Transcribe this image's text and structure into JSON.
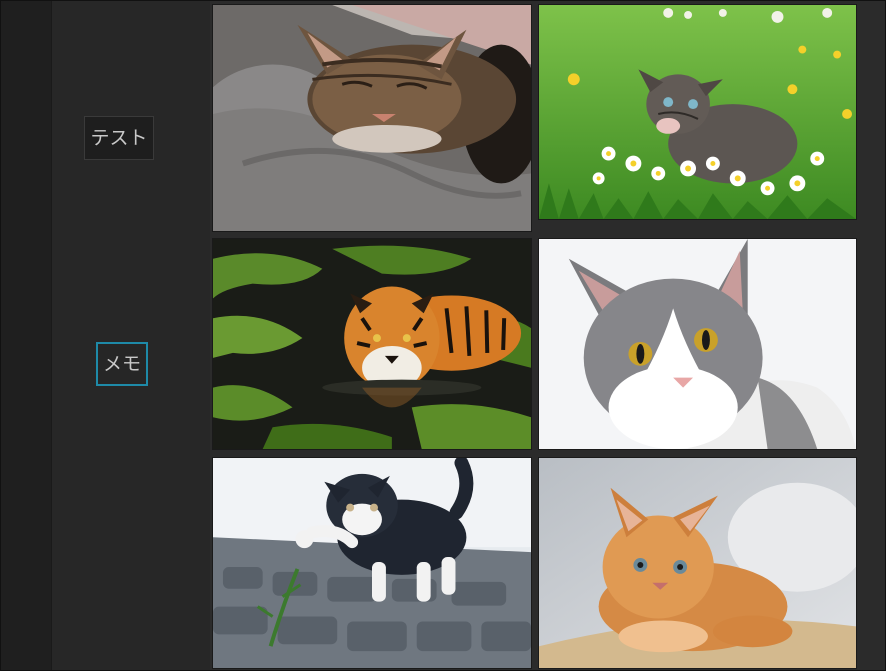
{
  "sidebar": {
    "tags": [
      {
        "label": "テスト",
        "selected": false
      },
      {
        "label": "メモ",
        "selected": true
      }
    ]
  },
  "gallery": {
    "images": [
      {
        "subject": "sleeping-tabby-cat"
      },
      {
        "subject": "kitten-in-daisy-field"
      },
      {
        "subject": "tiger-in-water"
      },
      {
        "subject": "gray-white-cat-portrait"
      },
      {
        "subject": "kitten-playing-on-cobblestones"
      },
      {
        "subject": "orange-kitten-lying"
      }
    ]
  },
  "colors": {
    "selected_border": "#1e8aa8",
    "background": "#282828"
  }
}
